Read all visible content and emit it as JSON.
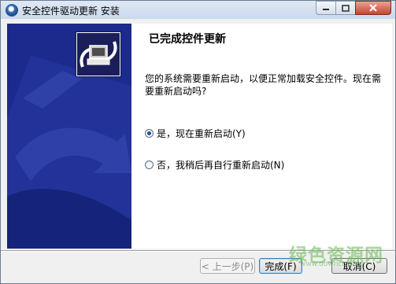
{
  "window": {
    "title": "安全控件驱动更新 安装",
    "app_icon": "installer-icon",
    "controls": {
      "minimize": "minimize-icon",
      "maximize": "maximize-icon",
      "close": "close-icon"
    }
  },
  "page": {
    "title": "已完成控件更新",
    "description": "您的系统需要重新启动，以便正常加载安全控件。现在需要重新启动吗?",
    "options": [
      {
        "label": "是，现在重新启动(Y)",
        "checked": true
      },
      {
        "label": "否，我稍后再自行重新启动(N)",
        "checked": false
      }
    ]
  },
  "buttons": {
    "back": "< 上一步(P)",
    "finish": "完成(F)",
    "cancel": "取消(C)"
  },
  "colors": {
    "side_panel": "#1b2a8c",
    "title_bar": "#c9d9ec"
  },
  "watermark": {
    "main": "绿色资源网",
    "sub": "www.downcc.com"
  }
}
